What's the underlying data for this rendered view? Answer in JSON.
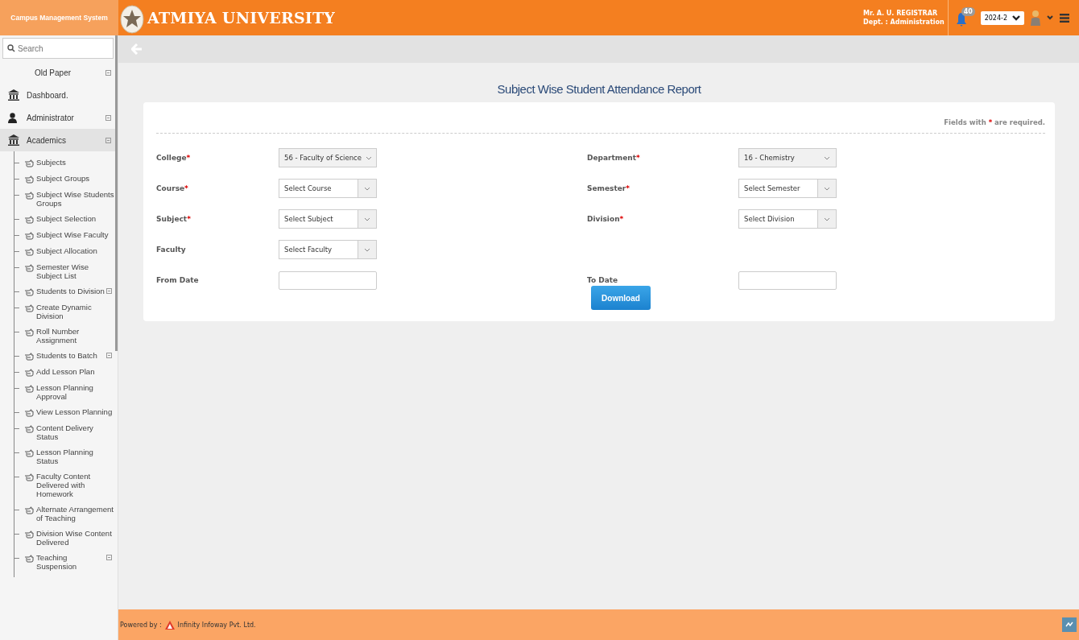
{
  "header": {
    "system_name": "Campus Management System",
    "university": "ATMIYA UNIVERSITY",
    "user_name": "Mr. A. U. REGISTRAR",
    "user_dept": "Dept. : Administration",
    "notification_count": "40",
    "year": "2024-2"
  },
  "sidebar": {
    "search": {
      "placeholder": "Search"
    },
    "items": [
      {
        "label": "Old Paper",
        "kind": "plain",
        "expandable": true,
        "selected": false
      },
      {
        "label": "Dashboard.",
        "kind": "dashboard",
        "expandable": false,
        "selected": false
      },
      {
        "label": "Administrator",
        "kind": "admin",
        "expandable": true,
        "selected": false
      },
      {
        "label": "Academics",
        "kind": "module",
        "expandable": true,
        "selected": true,
        "children": [
          {
            "label": "Subjects",
            "expandable": false
          },
          {
            "label": "Subject Groups",
            "expandable": false
          },
          {
            "label": "Subject Wise Students Groups",
            "expandable": false
          },
          {
            "label": "Subject Selection",
            "expandable": false
          },
          {
            "label": "Subject Wise Faculty",
            "expandable": false
          },
          {
            "label": "Subject Allocation",
            "expandable": false
          },
          {
            "label": "Semester Wise Subject List",
            "expandable": false
          },
          {
            "label": "Students to Division",
            "expandable": true
          },
          {
            "label": "Create Dynamic Division",
            "expandable": false
          },
          {
            "label": "Roll Number Assignment",
            "expandable": false
          },
          {
            "label": "Students to Batch",
            "expandable": true
          },
          {
            "label": "Add Lesson Plan",
            "expandable": false
          },
          {
            "label": "Lesson Planning Approval",
            "expandable": false
          },
          {
            "label": "View Lesson Planning",
            "expandable": false
          },
          {
            "label": "Content Delivery Status",
            "expandable": false
          },
          {
            "label": "Lesson Planning Status",
            "expandable": false
          },
          {
            "label": "Faculty Content Delivered with Homework",
            "expandable": false
          },
          {
            "label": "Alternate Arrangement of Teaching",
            "expandable": false
          },
          {
            "label": "Division Wise Content Delivered",
            "expandable": false
          },
          {
            "label": "Teaching Suspension",
            "expandable": true
          }
        ]
      }
    ]
  },
  "page": {
    "title": "Subject Wise Student Attendance Report",
    "required_note": {
      "before": "Fields with",
      "mark": "*",
      "after": "are required."
    },
    "fields": [
      {
        "label": "College",
        "required_mark": "*",
        "kind": "select",
        "value": "56 - Faculty of Science",
        "disabled": true
      },
      {
        "label": "Department",
        "required_mark": "*",
        "kind": "select",
        "value": "16 - Chemistry",
        "disabled": true
      },
      {
        "label": "Course",
        "required_mark": "*",
        "kind": "select",
        "value": "Select Course",
        "disabled": false
      },
      {
        "label": "Semester",
        "required_mark": "*",
        "kind": "select",
        "value": "Select Semester",
        "disabled": false
      },
      {
        "label": "Subject",
        "required_mark": "*",
        "kind": "select",
        "value": "Select Subject",
        "disabled": false
      },
      {
        "label": "Division",
        "required_mark": "*",
        "kind": "select",
        "value": "Select Division",
        "disabled": false
      },
      {
        "label": "Faculty",
        "kind": "select",
        "value": "Select Faculty",
        "disabled": false
      },
      {
        "kind": "empty"
      },
      {
        "label": "From Date",
        "kind": "date"
      },
      {
        "label": "To Date",
        "kind": "date"
      }
    ],
    "button": "Download"
  },
  "footer": {
    "powered_by": "Powered by :",
    "company": "Infinity Infoway Pvt. Ltd."
  }
}
